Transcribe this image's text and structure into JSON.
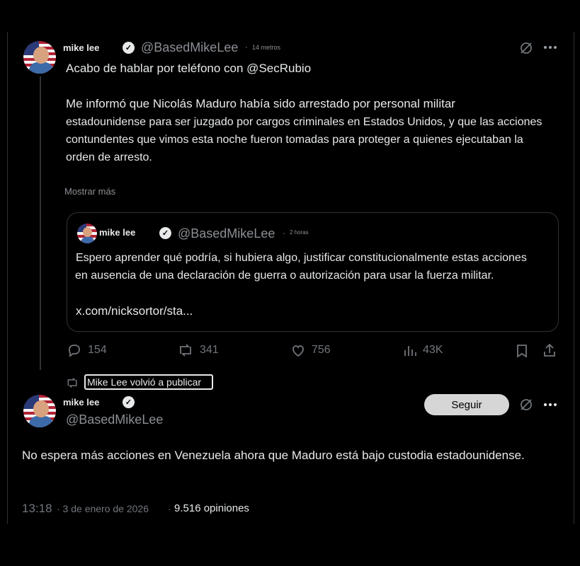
{
  "tweet1": {
    "name": "mike lee",
    "handle": "@BasedMikeLee",
    "dot": "·",
    "time": "14 metros",
    "line1": "Acabo de hablar por teléfono con @SecRubio",
    "para": [
      "Me informó que Nicolás Maduro había sido arrestado por personal militar",
      "estadounidense para ser juzgado por cargos criminales en Estados Unidos, y que las acciones",
      "contundentes que vimos esta noche fueron tomadas para proteger a quienes ejecutaban la",
      "orden de arresto."
    ],
    "show_more": "Mostrar más",
    "quote": {
      "name": "mike lee",
      "handle": "@BasedMikeLee",
      "dot": "·",
      "time": "2 horas",
      "text1": "Espero aprender qué podría, si hubiera algo, justificar constitucionalmente estas acciones",
      "text2": "en ausencia de una declaración de guerra o autorización para usar la fuerza militar.",
      "link": "x.com/nicksortor/sta..."
    },
    "stats": {
      "replies": "154",
      "reposts": "341",
      "likes": "756",
      "views": "43K"
    }
  },
  "repost_label": "Mike Lee volvió a publicar",
  "tweet2": {
    "name": "mike lee",
    "handle": "@BasedMikeLee",
    "follow_label": "Seguir",
    "text": "No espera más acciones en Venezuela ahora que Maduro está bajo custodia estadounidense.",
    "time": "13:18",
    "date": "· 3 de enero de 2026",
    "views_sep": "·",
    "views": "9.516 opiniones"
  },
  "icons": [
    "grok-icon",
    "more-icon",
    "reply-icon",
    "repost-icon",
    "like-icon",
    "views-icon",
    "bookmark-icon",
    "share-icon",
    "verified-icon"
  ]
}
